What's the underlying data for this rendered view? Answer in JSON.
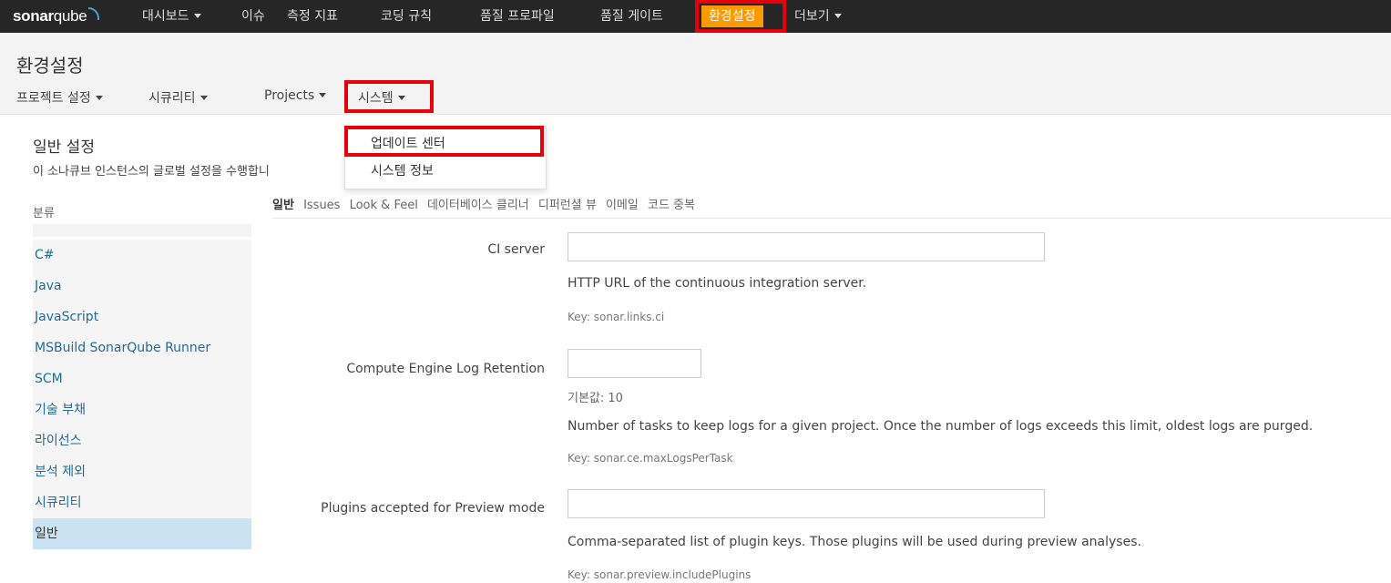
{
  "topnav": {
    "logo_bold": "sonar",
    "logo_rest": "qube",
    "items": [
      "대시보드",
      "이슈",
      "측정 지표",
      "코딩 규칙",
      "품질 프로파일",
      "품질 게이트",
      "환경설정",
      "더보기"
    ]
  },
  "page": {
    "title": "환경설정",
    "subnav": [
      "프로젝트 설정",
      "시큐리티",
      "Projects",
      "시스템"
    ]
  },
  "system_dropdown": {
    "items": [
      "업데이트 센터",
      "시스템 정보"
    ]
  },
  "general": {
    "title": "일반 설정",
    "description": "이 소나큐브 인스턴스의 글로벌 설정을 수행합니"
  },
  "categories": {
    "heading": "분류",
    "items": [
      "C#",
      "Java",
      "JavaScript",
      "MSBuild SonarQube Runner",
      "SCM",
      "기술 부채",
      "라이선스",
      "분석 제외",
      "시큐리티",
      "일반"
    ],
    "active": "일반"
  },
  "tabs": [
    "일반",
    "Issues",
    "Look & Feel",
    "데이터베이스 클리너",
    "디퍼런셜 뷰",
    "이메일",
    "코드 중복"
  ],
  "fields": [
    {
      "label": "CI server",
      "value": "",
      "description": "HTTP URL of the continuous integration server.",
      "key": "Key: sonar.links.ci"
    },
    {
      "label": "Compute Engine Log Retention",
      "value": "",
      "default": "기본값: 10",
      "description": "Number of tasks to keep logs for a given project. Once the number of logs exceeds this limit, oldest logs are purged.",
      "key": "Key: sonar.ce.maxLogsPerTask"
    },
    {
      "label": "Plugins accepted for Preview mode",
      "value": "",
      "description": "Comma-separated list of plugin keys. Those plugins will be used during preview analyses.",
      "key": "Key: sonar.preview.includePlugins"
    }
  ],
  "colors": {
    "navbar": "#262626",
    "active_nav": "#ff9900",
    "highlight_box": "#e5000b",
    "link": "#236a97",
    "active_category": "#cae3f2"
  }
}
